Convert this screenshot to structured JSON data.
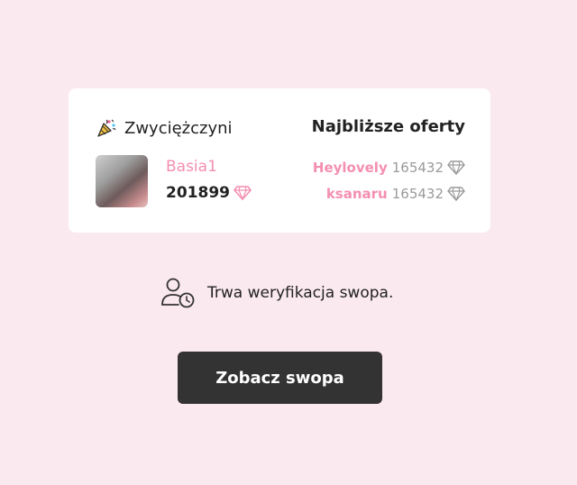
{
  "card": {
    "winner_title": "Zwyciężczyni",
    "winner_icon": "party-popper-icon",
    "offers_title": "Najbliższe oferty",
    "winner": {
      "name": "Basia1",
      "score": "201899",
      "score_icon": "diamond-icon"
    },
    "offers": [
      {
        "user": "Heylovely",
        "amount": "165432",
        "icon": "diamond-icon"
      },
      {
        "user": "ksanaru",
        "amount": "165432",
        "icon": "diamond-icon"
      }
    ]
  },
  "status": {
    "icon": "user-clock-icon",
    "text": "Trwa weryfikacja swopa."
  },
  "cta": {
    "label": "Zobacz swopa"
  },
  "colors": {
    "background": "#fbe9f0",
    "accent_pink": "#f48fb1",
    "button_bg": "#333333",
    "muted_text": "#9a9a9a"
  }
}
